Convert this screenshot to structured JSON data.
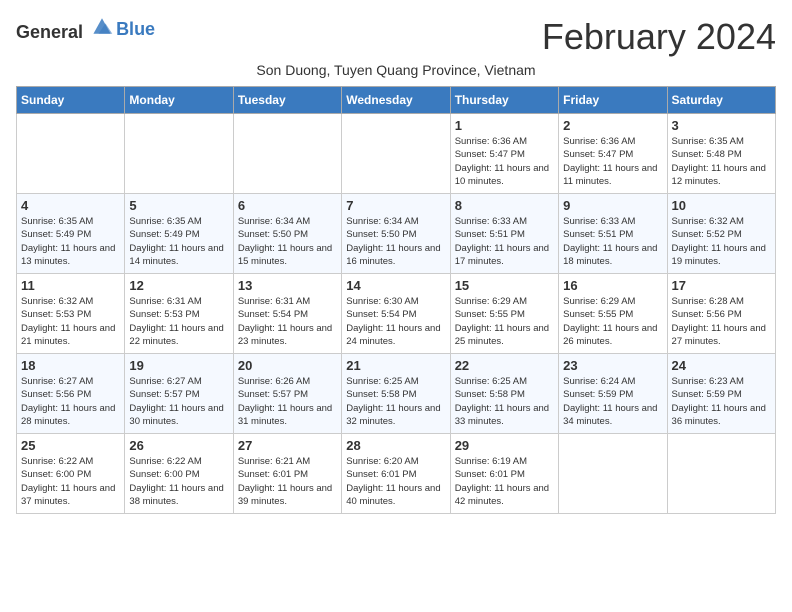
{
  "logo": {
    "line1": "General",
    "line2": "Blue"
  },
  "title": "February 2024",
  "location": "Son Duong, Tuyen Quang Province, Vietnam",
  "days_of_week": [
    "Sunday",
    "Monday",
    "Tuesday",
    "Wednesday",
    "Thursday",
    "Friday",
    "Saturday"
  ],
  "weeks": [
    [
      {
        "day": "",
        "info": ""
      },
      {
        "day": "",
        "info": ""
      },
      {
        "day": "",
        "info": ""
      },
      {
        "day": "",
        "info": ""
      },
      {
        "day": "1",
        "info": "Sunrise: 6:36 AM\nSunset: 5:47 PM\nDaylight: 11 hours and 10 minutes."
      },
      {
        "day": "2",
        "info": "Sunrise: 6:36 AM\nSunset: 5:47 PM\nDaylight: 11 hours and 11 minutes."
      },
      {
        "day": "3",
        "info": "Sunrise: 6:35 AM\nSunset: 5:48 PM\nDaylight: 11 hours and 12 minutes."
      }
    ],
    [
      {
        "day": "4",
        "info": "Sunrise: 6:35 AM\nSunset: 5:49 PM\nDaylight: 11 hours and 13 minutes."
      },
      {
        "day": "5",
        "info": "Sunrise: 6:35 AM\nSunset: 5:49 PM\nDaylight: 11 hours and 14 minutes."
      },
      {
        "day": "6",
        "info": "Sunrise: 6:34 AM\nSunset: 5:50 PM\nDaylight: 11 hours and 15 minutes."
      },
      {
        "day": "7",
        "info": "Sunrise: 6:34 AM\nSunset: 5:50 PM\nDaylight: 11 hours and 16 minutes."
      },
      {
        "day": "8",
        "info": "Sunrise: 6:33 AM\nSunset: 5:51 PM\nDaylight: 11 hours and 17 minutes."
      },
      {
        "day": "9",
        "info": "Sunrise: 6:33 AM\nSunset: 5:51 PM\nDaylight: 11 hours and 18 minutes."
      },
      {
        "day": "10",
        "info": "Sunrise: 6:32 AM\nSunset: 5:52 PM\nDaylight: 11 hours and 19 minutes."
      }
    ],
    [
      {
        "day": "11",
        "info": "Sunrise: 6:32 AM\nSunset: 5:53 PM\nDaylight: 11 hours and 21 minutes."
      },
      {
        "day": "12",
        "info": "Sunrise: 6:31 AM\nSunset: 5:53 PM\nDaylight: 11 hours and 22 minutes."
      },
      {
        "day": "13",
        "info": "Sunrise: 6:31 AM\nSunset: 5:54 PM\nDaylight: 11 hours and 23 minutes."
      },
      {
        "day": "14",
        "info": "Sunrise: 6:30 AM\nSunset: 5:54 PM\nDaylight: 11 hours and 24 minutes."
      },
      {
        "day": "15",
        "info": "Sunrise: 6:29 AM\nSunset: 5:55 PM\nDaylight: 11 hours and 25 minutes."
      },
      {
        "day": "16",
        "info": "Sunrise: 6:29 AM\nSunset: 5:55 PM\nDaylight: 11 hours and 26 minutes."
      },
      {
        "day": "17",
        "info": "Sunrise: 6:28 AM\nSunset: 5:56 PM\nDaylight: 11 hours and 27 minutes."
      }
    ],
    [
      {
        "day": "18",
        "info": "Sunrise: 6:27 AM\nSunset: 5:56 PM\nDaylight: 11 hours and 28 minutes."
      },
      {
        "day": "19",
        "info": "Sunrise: 6:27 AM\nSunset: 5:57 PM\nDaylight: 11 hours and 30 minutes."
      },
      {
        "day": "20",
        "info": "Sunrise: 6:26 AM\nSunset: 5:57 PM\nDaylight: 11 hours and 31 minutes."
      },
      {
        "day": "21",
        "info": "Sunrise: 6:25 AM\nSunset: 5:58 PM\nDaylight: 11 hours and 32 minutes."
      },
      {
        "day": "22",
        "info": "Sunrise: 6:25 AM\nSunset: 5:58 PM\nDaylight: 11 hours and 33 minutes."
      },
      {
        "day": "23",
        "info": "Sunrise: 6:24 AM\nSunset: 5:59 PM\nDaylight: 11 hours and 34 minutes."
      },
      {
        "day": "24",
        "info": "Sunrise: 6:23 AM\nSunset: 5:59 PM\nDaylight: 11 hours and 36 minutes."
      }
    ],
    [
      {
        "day": "25",
        "info": "Sunrise: 6:22 AM\nSunset: 6:00 PM\nDaylight: 11 hours and 37 minutes."
      },
      {
        "day": "26",
        "info": "Sunrise: 6:22 AM\nSunset: 6:00 PM\nDaylight: 11 hours and 38 minutes."
      },
      {
        "day": "27",
        "info": "Sunrise: 6:21 AM\nSunset: 6:01 PM\nDaylight: 11 hours and 39 minutes."
      },
      {
        "day": "28",
        "info": "Sunrise: 6:20 AM\nSunset: 6:01 PM\nDaylight: 11 hours and 40 minutes."
      },
      {
        "day": "29",
        "info": "Sunrise: 6:19 AM\nSunset: 6:01 PM\nDaylight: 11 hours and 42 minutes."
      },
      {
        "day": "",
        "info": ""
      },
      {
        "day": "",
        "info": ""
      }
    ]
  ]
}
